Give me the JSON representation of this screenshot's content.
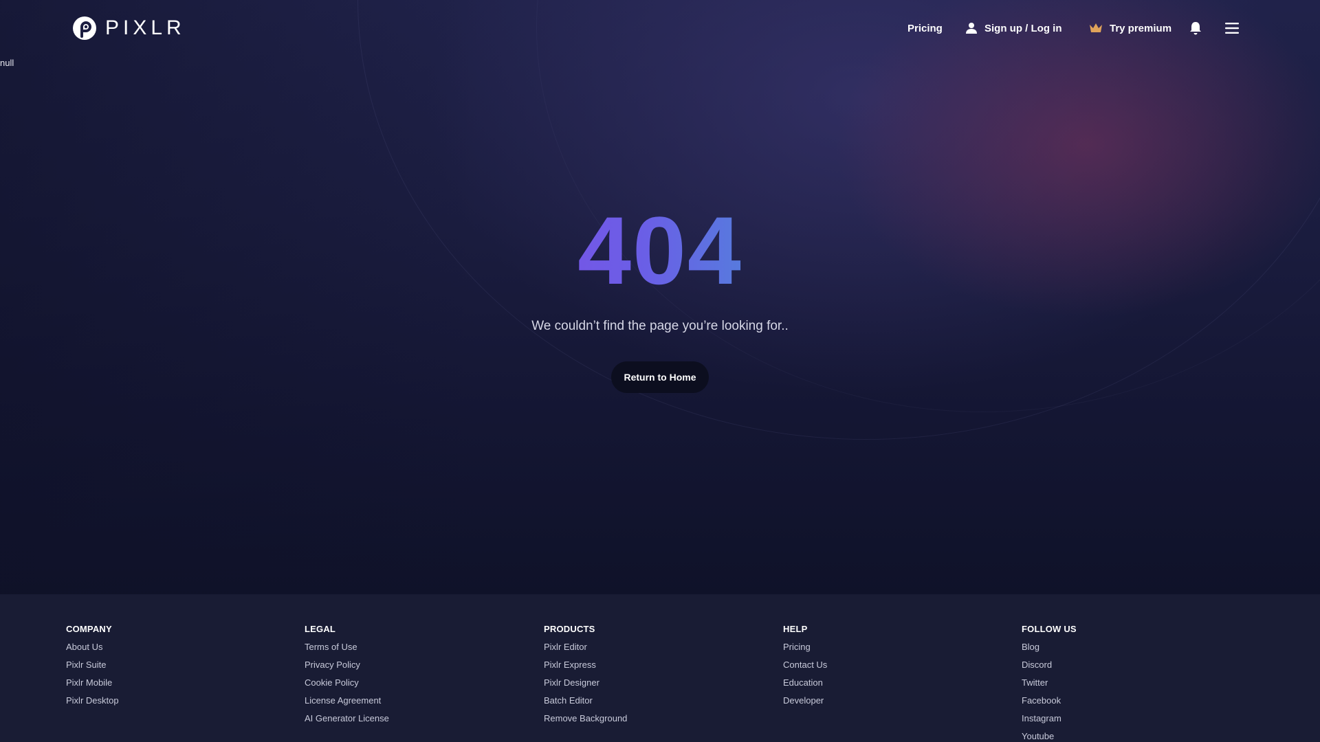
{
  "header": {
    "logo_text": "PIXLR",
    "nav": {
      "pricing": "Pricing",
      "login": "Sign up / Log in",
      "premium": "Try premium"
    },
    "icons": {
      "user": "user-icon",
      "premium": "crown-icon",
      "notifications": "bell-icon",
      "menu": "hamburger-menu-icon"
    }
  },
  "debug_text": "null",
  "error": {
    "code": "404",
    "message": "We couldn’t find the page you’re looking for..",
    "button_label": "Return to Home"
  },
  "footer": {
    "columns": [
      {
        "heading": "COMPANY",
        "links": [
          "About Us",
          "Pixlr Suite",
          "Pixlr Mobile",
          "Pixlr Desktop"
        ]
      },
      {
        "heading": "LEGAL",
        "links": [
          "Terms of Use",
          "Privacy Policy",
          "Cookie Policy",
          "License Agreement",
          "AI Generator License"
        ]
      },
      {
        "heading": "PRODUCTS",
        "links": [
          "Pixlr Editor",
          "Pixlr Express",
          "Pixlr Designer",
          "Batch Editor",
          "Remove Background"
        ]
      },
      {
        "heading": "HELP",
        "links": [
          "Pricing",
          "Contact Us",
          "Education",
          "Developer"
        ]
      },
      {
        "heading": "FOLLOW US",
        "links": [
          "Blog",
          "Discord",
          "Twitter",
          "Facebook",
          "Instagram",
          "Youtube"
        ]
      }
    ]
  },
  "colors": {
    "background_top": "#20224a",
    "background_bottom": "#0f1229",
    "footer_background": "#191c34",
    "error_gradient_start": "#7a52e6",
    "error_gradient_end": "#4c8ad9",
    "button_background": "#0c0e1f",
    "crown": "#e0a35a"
  }
}
